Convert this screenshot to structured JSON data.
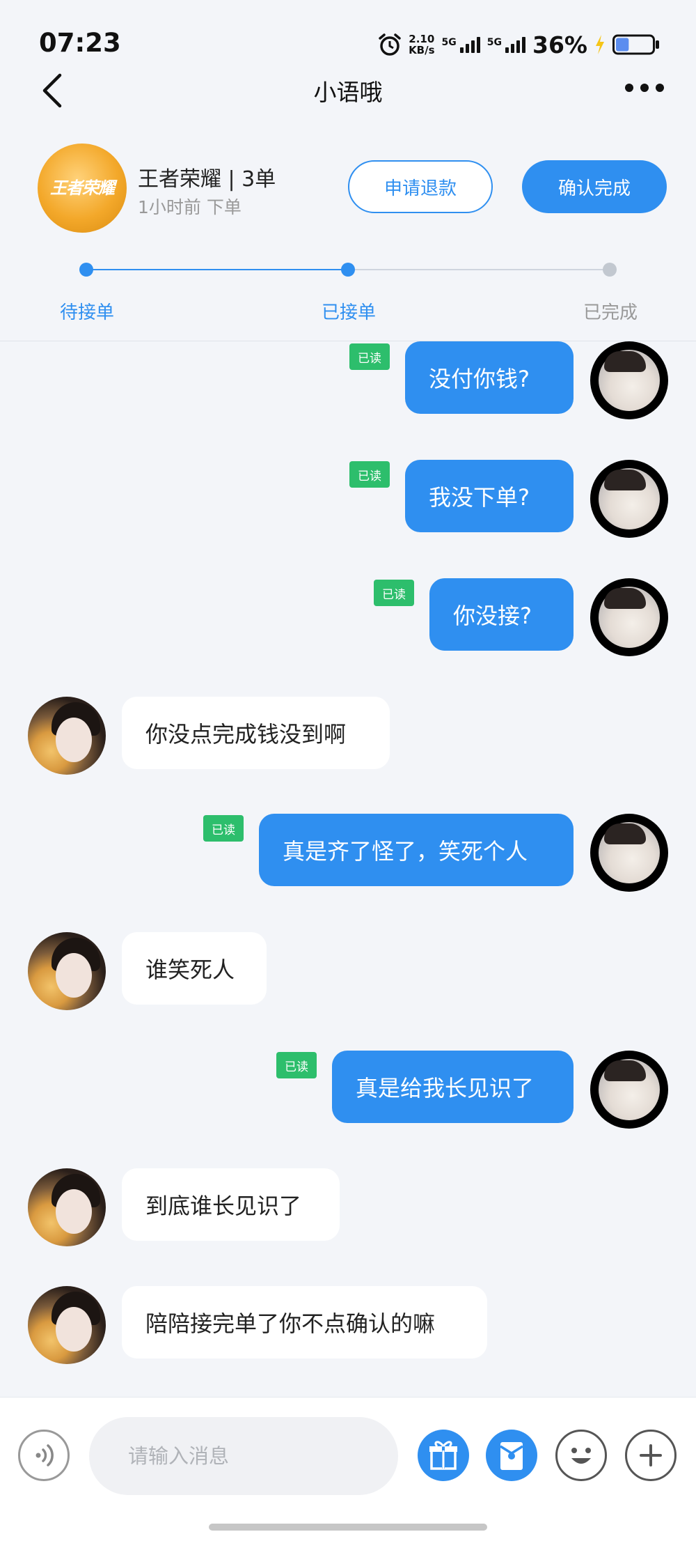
{
  "status_bar": {
    "time": "07:23",
    "net_speed_value": "2.10",
    "net_speed_unit": "KB/s",
    "sim1_label": "5G",
    "sim2_label": "5G",
    "battery_percent": "36%",
    "battery_level": 0.36
  },
  "header": {
    "title": "小语哦"
  },
  "order": {
    "game_logo_text": "王者荣耀",
    "game_name": "王者荣耀 | 3单",
    "time": "1小时前 下单",
    "refund_label": "申请退款",
    "confirm_label": "确认完成",
    "steps": [
      {
        "label": "待接单",
        "state": "done"
      },
      {
        "label": "已接单",
        "state": "current"
      },
      {
        "label": "已完成",
        "state": "pending"
      }
    ],
    "active_color": "#2f8ff0",
    "inactive_color": "#c2c8d0"
  },
  "messages": [
    {
      "sender": "me",
      "text": "没付你钱?",
      "read_label": "已读"
    },
    {
      "sender": "me",
      "text": "我没下单?",
      "read_label": "已读"
    },
    {
      "sender": "me",
      "text": "你没接?",
      "read_label": "已读"
    },
    {
      "sender": "her",
      "text": "你没点完成钱没到啊"
    },
    {
      "sender": "me",
      "text": "真是齐了怪了，笑死个人",
      "read_label": "已读"
    },
    {
      "sender": "her",
      "text": "谁笑死人"
    },
    {
      "sender": "me",
      "text": "真是给我长见识了",
      "read_label": "已读"
    },
    {
      "sender": "her",
      "text": "到底谁长见识了"
    },
    {
      "sender": "her",
      "text": "陪陪接完单了你不点确认的嘛"
    }
  ],
  "input_bar": {
    "placeholder": "请输入消息",
    "icons": [
      "voice-icon",
      "gift-icon",
      "red-packet-icon",
      "emoji-icon",
      "plus-icon"
    ]
  },
  "colors": {
    "accent": "#2f8ff0",
    "read_badge": "#2dbe6c",
    "background": "#f3f5f9"
  }
}
